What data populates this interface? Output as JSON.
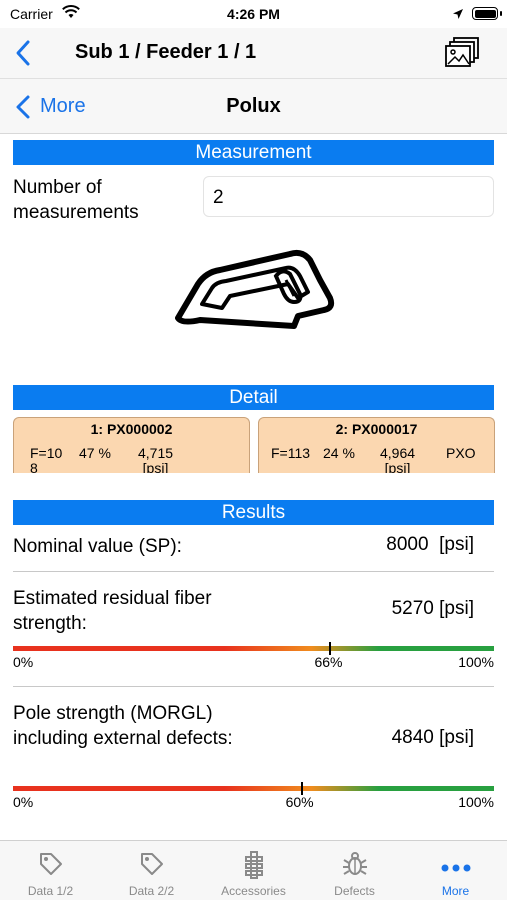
{
  "status": {
    "carrier": "Carrier",
    "time": "4:26 PM"
  },
  "nav": {
    "title": "Sub 1 / Feeder 1 / 1",
    "back_label": "More",
    "screen_title": "Polux"
  },
  "measurement": {
    "header": "Measurement",
    "count_label": "Number of measurements",
    "count_value": "2"
  },
  "detail": {
    "header": "Detail",
    "cards": [
      {
        "title": "1:  PX000002",
        "f": "F=10\n8",
        "pct": "47 %",
        "val": "4,715",
        "unit": "[psi]",
        "extra": ""
      },
      {
        "title": "2:  PX000017",
        "f": "F=113",
        "pct": "24 %",
        "val": "4,964",
        "unit": "[psi]",
        "extra": "PXO"
      }
    ]
  },
  "results": {
    "header": "Results",
    "nominal": {
      "label": "Nominal value (SP):",
      "value": "8000",
      "unit": "[psi]"
    },
    "residual": {
      "label": "Estimated residual fiber strength:",
      "value": "5270",
      "unit": "[psi]",
      "bar_level": 0.66,
      "min": "0%",
      "mark": "66%",
      "max": "100%"
    },
    "pole": {
      "label": "Pole strength (MORGL) including external defects:",
      "value": "4840",
      "unit": "[psi]",
      "bar_level": 0.6,
      "min": "0%",
      "mark": "60%",
      "max": "100%"
    }
  },
  "tabs": [
    {
      "label": "Data 1/2",
      "icon": "tag-icon"
    },
    {
      "label": "Data 2/2",
      "icon": "tag-icon"
    },
    {
      "label": "Accessories",
      "icon": "insulator-icon"
    },
    {
      "label": "Defects",
      "icon": "bug-icon"
    },
    {
      "label": "More",
      "icon": "more-dots-icon",
      "active": true
    }
  ],
  "colors": {
    "accent": "#0a7cf0",
    "link": "#1a73e8",
    "card": "#fbd7b0"
  }
}
